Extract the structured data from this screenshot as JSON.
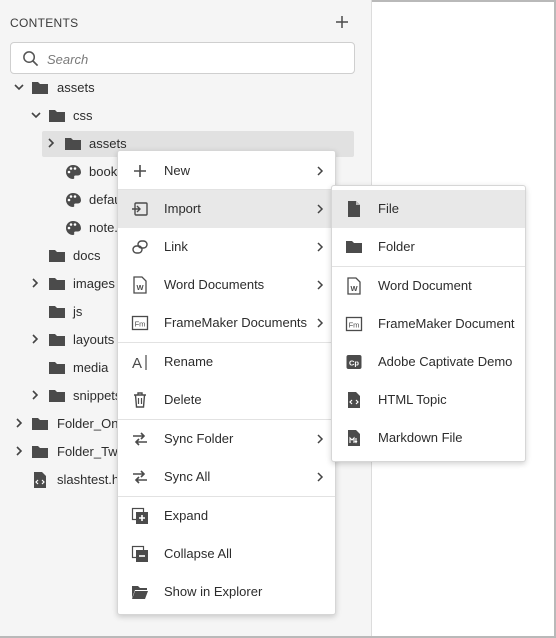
{
  "panel": {
    "title": "CONTENTS",
    "search_placeholder": "Search"
  },
  "tree": [
    {
      "label": "assets",
      "type": "folder"
    },
    {
      "label": "css",
      "type": "folder"
    },
    {
      "label": "assets",
      "type": "folder"
    },
    {
      "label": "book",
      "type": "css"
    },
    {
      "label": "defau",
      "type": "css"
    },
    {
      "label": "note.",
      "type": "css"
    },
    {
      "label": "docs",
      "type": "folder"
    },
    {
      "label": "images",
      "type": "folder"
    },
    {
      "label": "js",
      "type": "folder"
    },
    {
      "label": "layouts",
      "type": "folder"
    },
    {
      "label": "media",
      "type": "folder"
    },
    {
      "label": "snippets",
      "type": "folder"
    },
    {
      "label": "Folder_On",
      "type": "folder"
    },
    {
      "label": "Folder_Tw",
      "type": "folder"
    },
    {
      "label": "slashtest.ht",
      "type": "html"
    }
  ],
  "context_menu": [
    {
      "label": "New",
      "icon": "plus-icon",
      "submenu": true
    },
    {
      "label": "Import",
      "icon": "import-icon",
      "submenu": true
    },
    {
      "label": "Link",
      "icon": "link-icon",
      "submenu": true
    },
    {
      "label": "Word Documents",
      "icon": "word-doc-icon",
      "submenu": true
    },
    {
      "label": "FrameMaker Documents",
      "icon": "framemaker-icon",
      "submenu": true
    },
    {
      "label": "Rename",
      "icon": "rename-icon",
      "submenu": false
    },
    {
      "label": "Delete",
      "icon": "trash-icon",
      "submenu": false
    },
    {
      "label": "Sync Folder",
      "icon": "sync-icon",
      "submenu": true
    },
    {
      "label": "Sync All",
      "icon": "sync-icon",
      "submenu": true
    },
    {
      "label": "Expand",
      "icon": "expand-icon",
      "submenu": false
    },
    {
      "label": "Collapse All",
      "icon": "collapse-icon",
      "submenu": false
    },
    {
      "label": "Show in Explorer",
      "icon": "folder-open-icon",
      "submenu": false
    }
  ],
  "import_submenu": [
    {
      "label": "File",
      "icon": "file-icon"
    },
    {
      "label": "Folder",
      "icon": "folder-icon"
    },
    {
      "label": "Word Document",
      "icon": "word-doc-icon"
    },
    {
      "label": "FrameMaker Document",
      "icon": "framemaker-icon"
    },
    {
      "label": "Adobe Captivate Demo",
      "icon": "captivate-icon"
    },
    {
      "label": "HTML Topic",
      "icon": "html-topic-icon"
    },
    {
      "label": "Markdown File",
      "icon": "markdown-icon"
    }
  ],
  "icon_glyphs": {
    "word": "W",
    "framemaker": "Fm",
    "captivate": "Cp",
    "rename": "A"
  },
  "colors": {
    "panel_bg": "#f5f5f5",
    "selected_row": "#e1e1e1",
    "menu_highlight": "#e8e8e8",
    "icon": "#4b4b4b"
  }
}
